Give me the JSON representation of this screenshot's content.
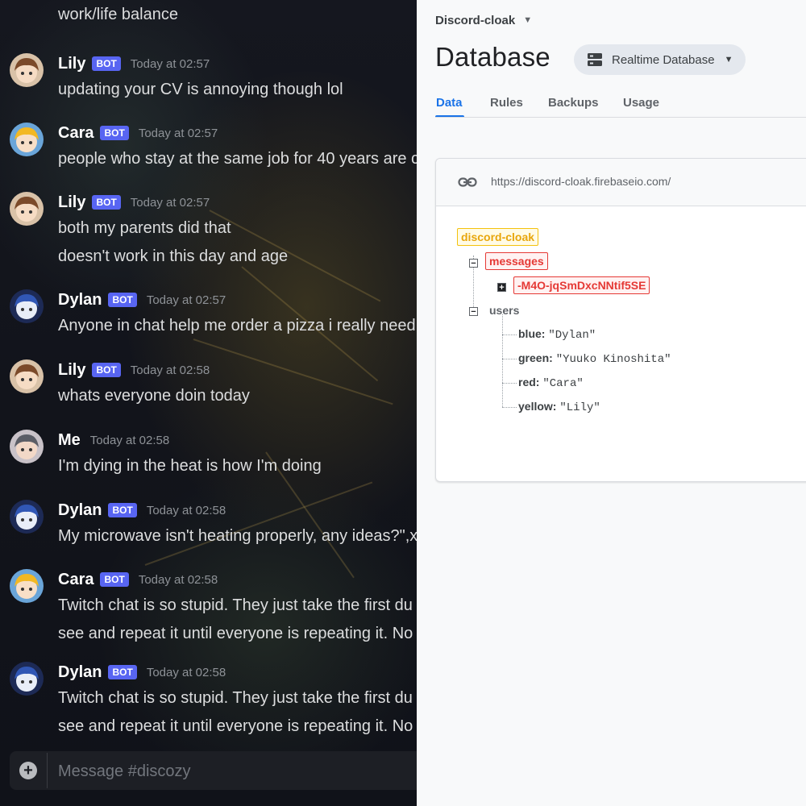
{
  "discord": {
    "partial_top_text": "work/life balance",
    "messages": [
      {
        "author": "Lily",
        "bot_label": "BOT",
        "time": "Today at 02:57",
        "lines": [
          "updating your CV is annoying though lol"
        ]
      },
      {
        "author": "Cara",
        "bot_label": "BOT",
        "time": "Today at 02:57",
        "lines": [
          "people who stay at the same job for 40 years are c"
        ]
      },
      {
        "author": "Lily",
        "bot_label": "BOT",
        "time": "Today at 02:57",
        "lines": [
          "both my parents did that",
          "doesn't work in this day and age"
        ]
      },
      {
        "author": "Dylan",
        "bot_label": "BOT",
        "time": "Today at 02:57",
        "lines": [
          "Anyone in chat help me order a pizza i really need"
        ]
      },
      {
        "author": "Lily",
        "bot_label": "BOT",
        "time": "Today at 02:58",
        "lines": [
          "whats everyone doin today"
        ]
      },
      {
        "author": "Me",
        "bot_label": "",
        "time": "Today at 02:58",
        "lines": [
          "I'm dying in the heat is how I'm doing"
        ]
      },
      {
        "author": "Dylan",
        "bot_label": "BOT",
        "time": "Today at 02:58",
        "lines": [
          "My microwave isn't heating properly, any ideas?\",x"
        ]
      },
      {
        "author": "Cara",
        "bot_label": "BOT",
        "time": "Today at 02:58",
        "lines": [
          "Twitch chat is so stupid. They just take the first du",
          "see and repeat it until everyone is repeating it. No c"
        ]
      },
      {
        "author": "Dylan",
        "bot_label": "BOT",
        "time": "Today at 02:58",
        "lines": [
          "Twitch chat is so stupid. They just take the first du",
          "see and repeat it until everyone is repeating it. No c"
        ]
      }
    ],
    "composer": {
      "placeholder": "Message #discozy"
    }
  },
  "firebase": {
    "project_name": "Discord-cloak",
    "page_title": "Database",
    "db_selector_label": "Realtime Database",
    "tabs": [
      "Data",
      "Rules",
      "Backups",
      "Usage"
    ],
    "active_tab": "Data",
    "url": "https://discord-cloak.firebaseio.com/",
    "tree": {
      "root": "discord-cloak",
      "messages_key": "messages",
      "message_id": "-M4O-jqSmDxcNNtif5SE",
      "users_key": "users",
      "users": [
        {
          "key": "blue:",
          "value": "\"Dylan\""
        },
        {
          "key": "green:",
          "value": "\"Yuuko Kinoshita\""
        },
        {
          "key": "red:",
          "value": "\"Cara\""
        },
        {
          "key": "yellow:",
          "value": "\"Lily\""
        }
      ]
    }
  },
  "colors": {
    "discord_bot_badge": "#5865f2",
    "firebase_accent": "#1a73e8",
    "root_node": "#f4c20d",
    "changed_node": "#e53935"
  }
}
